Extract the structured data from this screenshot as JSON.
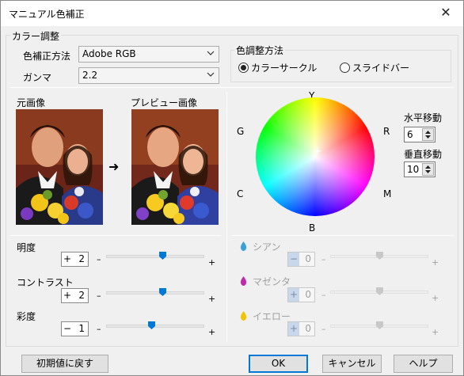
{
  "window": {
    "title": "マニュアル色補正",
    "close_glyph": "✕"
  },
  "color_adjust": {
    "legend": "カラー調整",
    "correction_label": "色補正方法",
    "correction_value": "Adobe RGB",
    "gamma_label": "ガンマ",
    "gamma_value": "2.2"
  },
  "method": {
    "legend": "色調整方法",
    "options": [
      {
        "label": "カラーサークル",
        "selected": true
      },
      {
        "label": "スライドバー",
        "selected": false
      }
    ]
  },
  "preview": {
    "original_label": "元画像",
    "preview_label": "プレビュー画像",
    "arrow": "➜"
  },
  "wheel": {
    "Y": "Y",
    "G": "G",
    "R": "R",
    "C": "C",
    "M": "M",
    "B": "B",
    "center": "+"
  },
  "shift": {
    "horizontal_label": "水平移動",
    "horizontal_value": "6",
    "vertical_label": "垂直移動",
    "vertical_value": "10"
  },
  "adjust": [
    {
      "label": "明度",
      "sign": "+",
      "value": "2",
      "level": 0.58
    },
    {
      "label": "コントラスト",
      "sign": "+",
      "value": "2",
      "level": 0.58
    },
    {
      "label": "彩度",
      "sign": "−",
      "value": "1",
      "level": 0.46
    }
  ],
  "ink": [
    {
      "label": "シアン",
      "sign": "−",
      "value": "0",
      "color": "#3aa0d8",
      "level": 0.5
    },
    {
      "label": "マゼンタ",
      "sign": "+",
      "value": "0",
      "color": "#c02aa8",
      "level": 0.5
    },
    {
      "label": "イエロー",
      "sign": "+",
      "value": "0",
      "color": "#f2c400",
      "level": 0.5
    }
  ],
  "slider_marks": {
    "minus": "–",
    "plus": "+"
  },
  "buttons": {
    "reset": "初期値に戻す",
    "ok": "OK",
    "cancel": "キャンセル",
    "help": "ヘルプ"
  }
}
